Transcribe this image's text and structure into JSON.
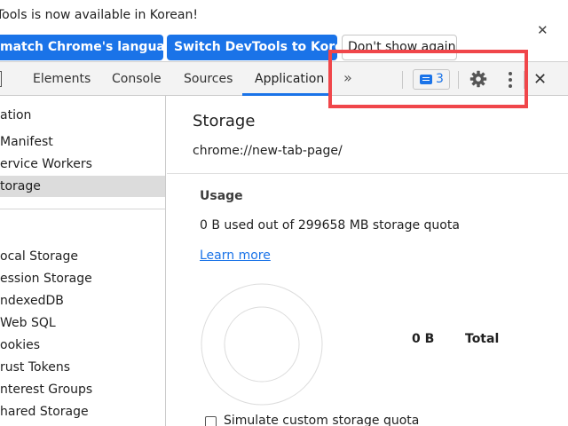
{
  "infobar": {
    "message": "Tools is now available in Korean!",
    "match_button": "match Chrome's language",
    "switch_button": "Switch DevTools to Korean",
    "dont_show_button": "Don't show again",
    "close_icon": "close-icon"
  },
  "tabs": {
    "items": [
      "Elements",
      "Console",
      "Sources",
      "Application"
    ],
    "active": "Application",
    "more": "»",
    "issues_count": "3"
  },
  "sidebar": {
    "items": [
      "ation",
      "Manifest",
      "ervice Workers",
      "torage",
      "ocal Storage",
      "ession Storage",
      "ndexedDB",
      "Web SQL",
      "ookies",
      "rust Tokens",
      "nterest Groups",
      "hared Storage"
    ],
    "selected": "torage"
  },
  "main": {
    "title": "Storage",
    "origin": "chrome://new-tab-page/",
    "usage_heading": "Usage",
    "usage_text": "0 B used out of 299658 MB storage quota",
    "learn_more": "Learn more",
    "total_value": "0 B",
    "total_label": "Total",
    "simulate_label": "Simulate custom storage quota"
  },
  "colors": {
    "accent": "#1a73e8",
    "highlight": "#f0464a",
    "selected_bg": "#dcdcdc"
  }
}
